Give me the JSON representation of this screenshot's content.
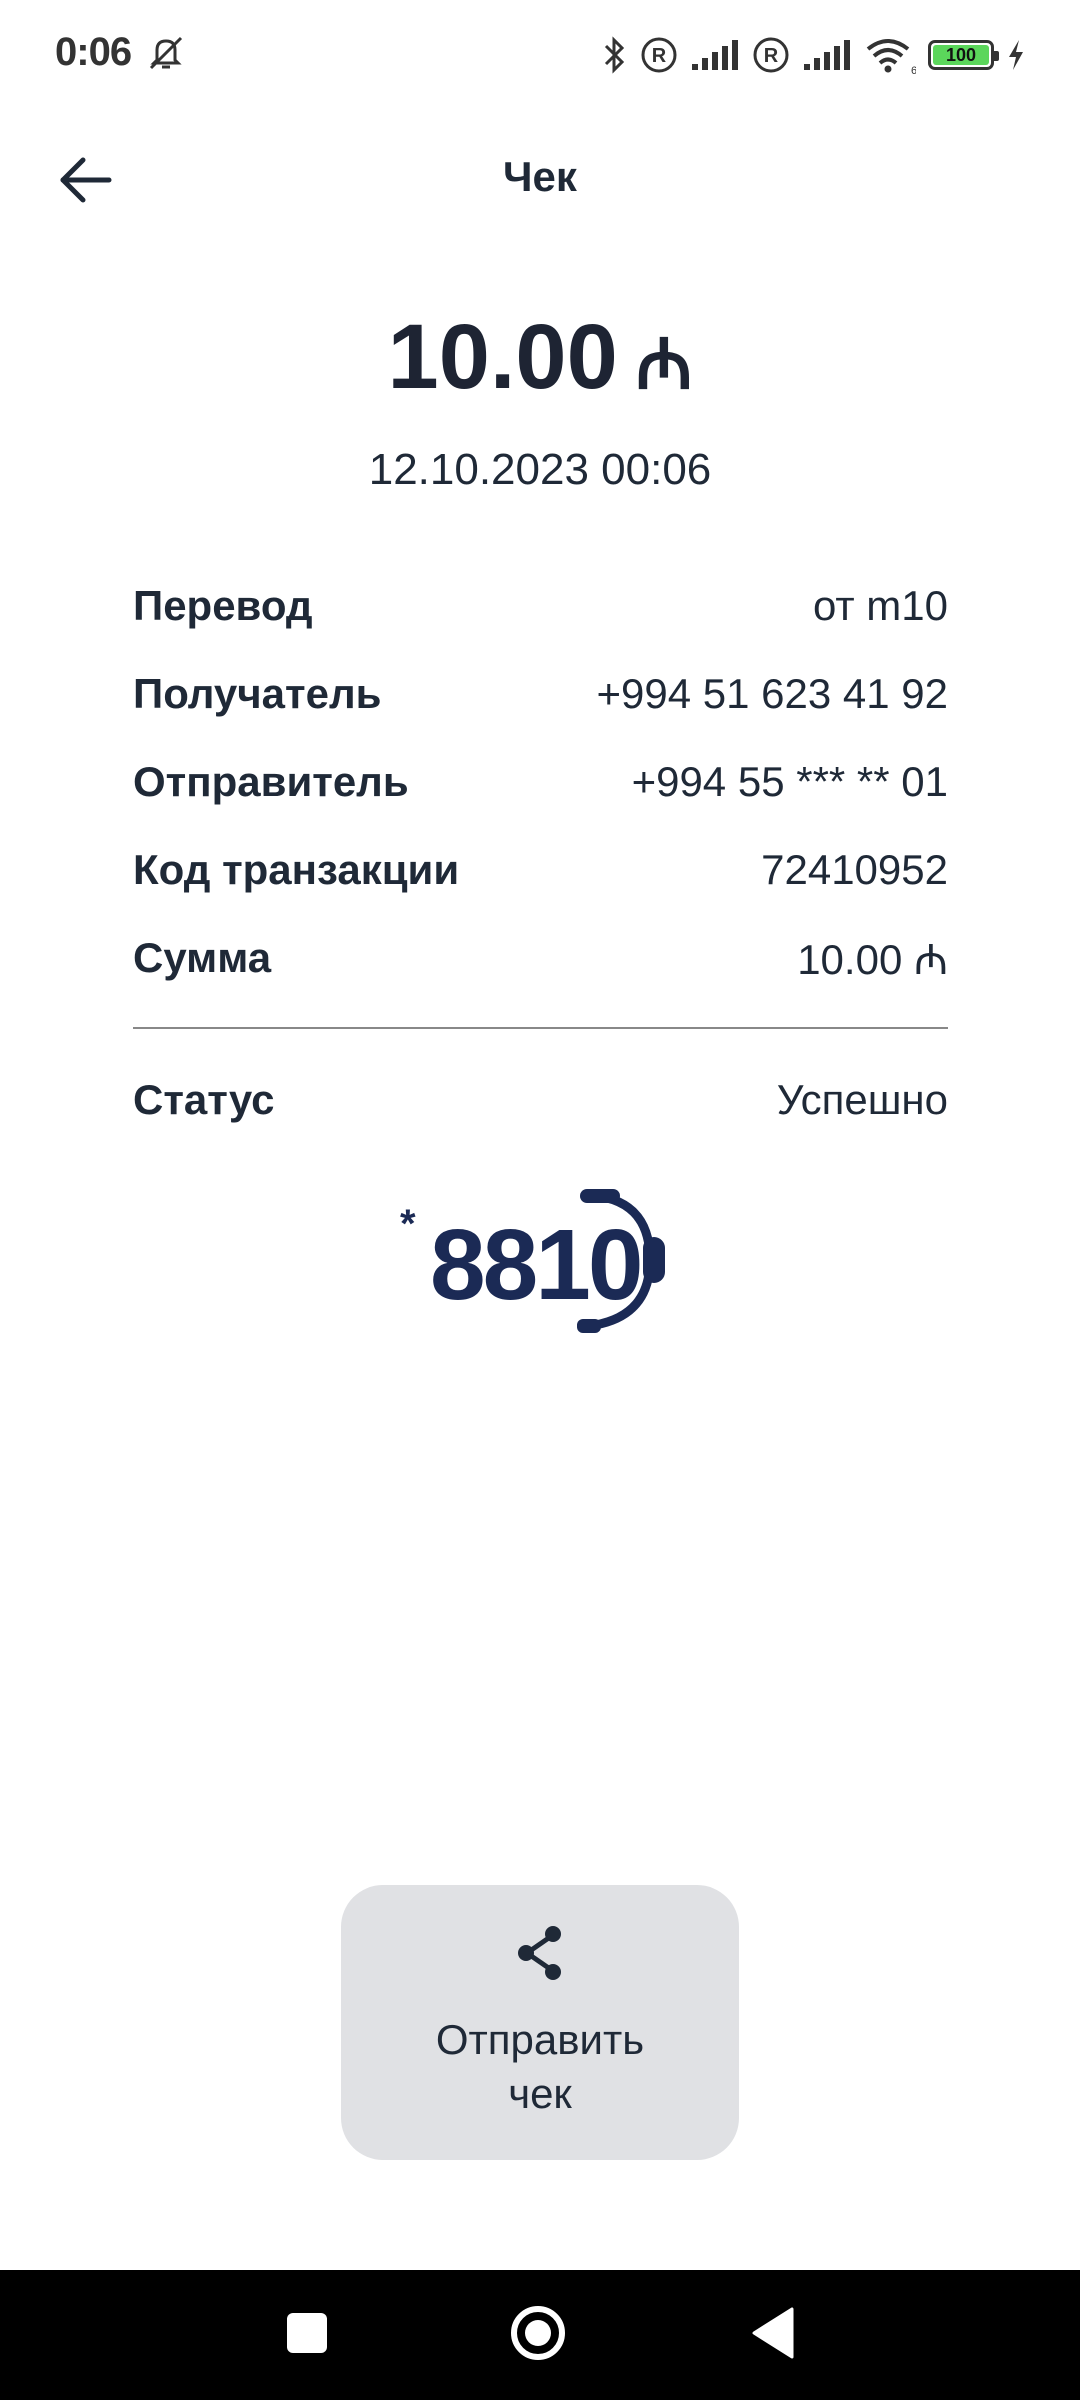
{
  "status_bar": {
    "time": "0:06",
    "battery_level": "100",
    "icons": [
      "mute-icon",
      "bluetooth-icon",
      "roaming-icon",
      "signal-icon",
      "roaming-icon",
      "signal-icon",
      "wifi-icon",
      "battery-icon",
      "charging-icon"
    ],
    "battery_color": "#5bd65b"
  },
  "header": {
    "title": "Чек",
    "back_icon": "arrow-left-icon"
  },
  "receipt": {
    "amount": "10.00",
    "currency_symbol": "₼",
    "datetime": "12.10.2023 00:06",
    "rows": [
      {
        "label": "Перевод",
        "value": "от m10"
      },
      {
        "label": "Получатель",
        "value": "+994 51 623 41 92"
      },
      {
        "label": "Отправитель",
        "value": "+994 55 *** ** 01"
      },
      {
        "label": "Код транзакции",
        "value": "72410952"
      },
      {
        "label": "Сумма",
        "value": "10.00 ₼"
      }
    ],
    "status_label": "Статус",
    "status_value": "Успешно"
  },
  "logo": {
    "text": "8810",
    "star": "*",
    "color": "#1b2a55"
  },
  "share_button": {
    "label": "Отправить\nчек",
    "icon": "share-icon",
    "background": "#e0e1e4"
  },
  "nav_bar": {
    "icons": [
      "recents-icon",
      "home-icon",
      "back-icon"
    ]
  }
}
